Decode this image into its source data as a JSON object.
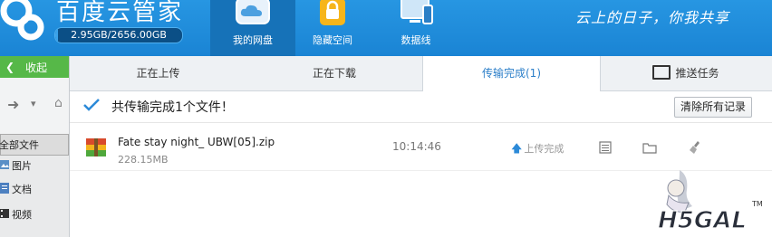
{
  "header": {
    "title": "百度云管家",
    "quota": "2.95GB/2656.00GB",
    "quota_fraction": 0.0011,
    "slogan": "云上的日子，你我共享",
    "nav": [
      {
        "label": "我的网盘",
        "icon": "cloud-drive-icon",
        "active": true
      },
      {
        "label": "隐藏空间",
        "icon": "lock-icon",
        "active": false
      },
      {
        "label": "数据线",
        "icon": "devices-icon",
        "active": false
      }
    ]
  },
  "sidebar": {
    "collapse_label": "收起",
    "all_files": "全部文件",
    "items": [
      {
        "label": "图片",
        "icon": "picture-icon"
      },
      {
        "label": "文档",
        "icon": "document-icon"
      },
      {
        "label": "视频",
        "icon": "video-icon"
      }
    ]
  },
  "tabs": [
    {
      "label": "正在上传"
    },
    {
      "label": "正在下载"
    },
    {
      "label": "传输完成(1)"
    },
    {
      "label": "推送任务"
    }
  ],
  "summary": {
    "text": "共传输完成1个文件！",
    "clear_button": "清除所有记录"
  },
  "files": [
    {
      "name": "Fate stay night_ UBW[05].zip",
      "size": "228.15MB",
      "time": "10:14:46",
      "status": "上传完成"
    }
  ],
  "watermark": {
    "text": "H5GAL",
    "tm": "TM"
  },
  "colors": {
    "header": "#1a84d4",
    "accent": "#2c7fc9",
    "collapse": "#56b848"
  }
}
